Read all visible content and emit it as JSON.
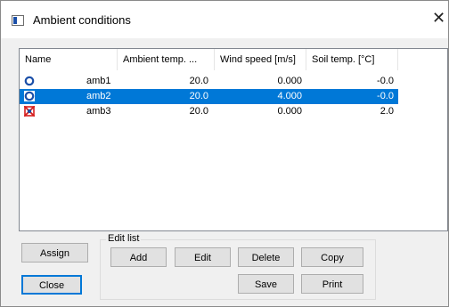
{
  "window": {
    "title": "Ambient conditions"
  },
  "columns": [
    "Name",
    "Ambient temp. ...",
    "Wind speed [m/s]",
    "Soil temp. [°C]"
  ],
  "rows": [
    {
      "name": "amb1",
      "ambient": "20.0",
      "wind": "0.000",
      "soil": "-0.0",
      "icon": "circle-icon",
      "selected": false
    },
    {
      "name": "amb2",
      "ambient": "20.0",
      "wind": "4.000",
      "soil": "-0.0",
      "icon": "circle-icon",
      "selected": true
    },
    {
      "name": "amb3",
      "ambient": "20.0",
      "wind": "0.000",
      "soil": "2.0",
      "icon": "crossed-box-icon",
      "selected": false
    }
  ],
  "group": {
    "label": "Edit list"
  },
  "buttons": {
    "assign": "Assign",
    "close": "Close",
    "add": "Add",
    "edit": "Edit",
    "delete": "Delete",
    "copy": "Copy",
    "save": "Save",
    "print": "Print"
  },
  "colors": {
    "selection": "#0078d7",
    "icon_blue": "#1b4fa8",
    "icon_red": "#d61f1f"
  }
}
